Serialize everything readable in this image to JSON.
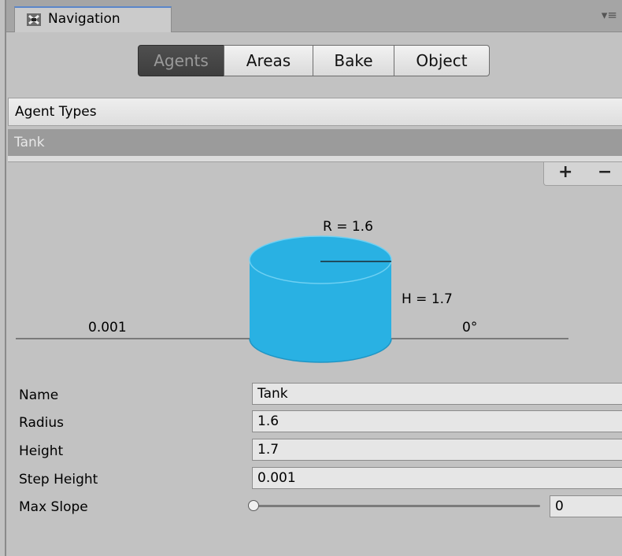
{
  "window": {
    "tab_title": "Navigation",
    "tab_icon": "navigation-icon",
    "menu_icon": "context-menu-icon"
  },
  "toolbar": {
    "tabs": [
      "Agents",
      "Areas",
      "Bake",
      "Object"
    ],
    "selected": "Agents"
  },
  "agent_types": {
    "header": "Agent Types",
    "items": [
      "Tank"
    ],
    "selected": "Tank",
    "add_label": "+",
    "remove_label": "−"
  },
  "diagram": {
    "radius_label": "R = 1.6",
    "height_label": "H = 1.7",
    "step_label": "0.001",
    "slope_label": "0°",
    "cylinder_color": "#29b1e3"
  },
  "fields": {
    "name_label": "Name",
    "name_value": "Tank",
    "radius_label": "Radius",
    "radius_value": "1.6",
    "height_label": "Height",
    "height_value": "1.7",
    "step_label": "Step Height",
    "step_value": "0.001",
    "slope_label": "Max Slope",
    "slope_value": "0",
    "slope_fraction": 0
  }
}
